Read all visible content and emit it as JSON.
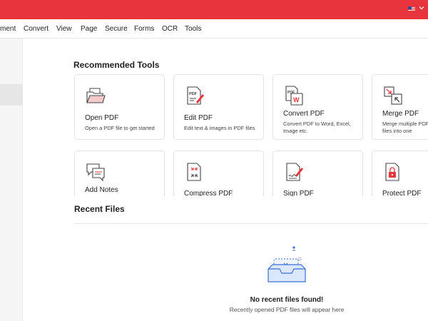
{
  "titlebar": {
    "flag_icon": "us-flag-icon",
    "dropdown_icon": "chevron-down-icon",
    "accent": "#e8343c"
  },
  "menu": [
    "ment",
    "Convert",
    "View",
    "Page",
    "Secure",
    "Forms",
    "OCR",
    "Tools"
  ],
  "recommended": {
    "title": "Recommended Tools",
    "tools": [
      {
        "name": "Open PDF",
        "desc": "Open a PDF file to get started",
        "icon": "folder-open-icon"
      },
      {
        "name": "Edit PDF",
        "desc": "Edit text & images in PDF files",
        "icon": "edit-pdf-icon"
      },
      {
        "name": "Convert PDF",
        "desc": "Convert PDF to Word, Excel, Image etc.",
        "icon": "convert-pdf-icon"
      },
      {
        "name": "Merge PDF",
        "desc": "Merge multiple PDF files into one",
        "icon": "merge-pdf-icon"
      },
      {
        "name": "Add Notes",
        "desc": "",
        "icon": "add-notes-icon"
      },
      {
        "name": "Compress PDF",
        "desc": "",
        "icon": "compress-pdf-icon"
      },
      {
        "name": "Sign PDF",
        "desc": "",
        "icon": "sign-pdf-icon"
      },
      {
        "name": "Protect PDF",
        "desc": "",
        "icon": "protect-pdf-icon"
      }
    ]
  },
  "recent": {
    "title": "Recent Files",
    "empty_title": "No recent files found!",
    "empty_subtitle": "Recently opened PDF files will appear here",
    "empty_icon": "empty-tray-icon"
  }
}
